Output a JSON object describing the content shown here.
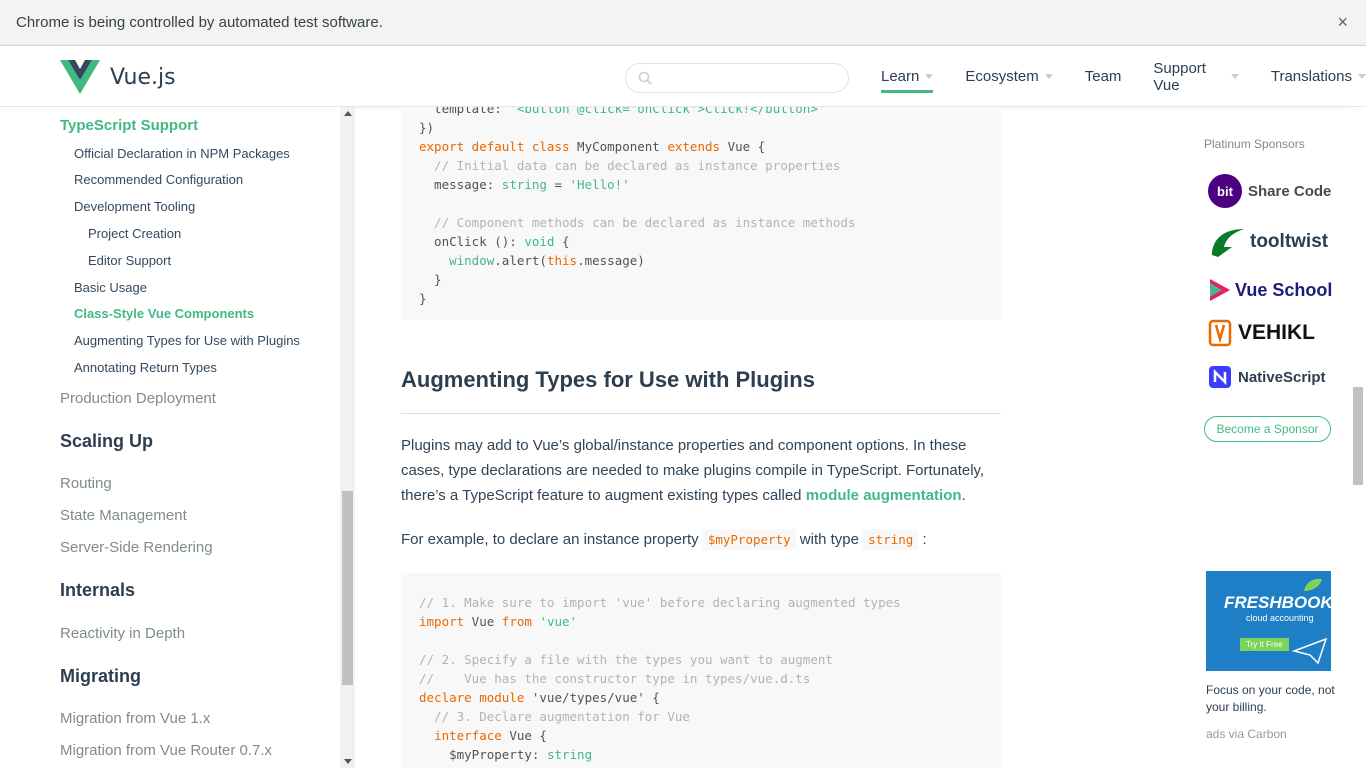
{
  "infobar": {
    "message": "Chrome is being controlled by automated test software.",
    "close": "×"
  },
  "header": {
    "logo_text": "Vue.js",
    "search_placeholder": "",
    "nav": [
      {
        "label": "Learn",
        "active": true,
        "dropdown": true
      },
      {
        "label": "Ecosystem",
        "dropdown": true
      },
      {
        "label": "Team",
        "dropdown": false
      },
      {
        "label": "Support Vue",
        "dropdown": true
      },
      {
        "label": "Translations",
        "dropdown": true
      }
    ]
  },
  "sidebar": {
    "items": [
      {
        "label": "TypeScript Support"
      },
      {
        "label": "Official Declaration in NPM Packages"
      },
      {
        "label": "Recommended Configuration"
      },
      {
        "label": "Development Tooling"
      },
      {
        "label": "Project Creation"
      },
      {
        "label": "Editor Support"
      },
      {
        "label": "Basic Usage"
      },
      {
        "label": "Class-Style Vue Components"
      },
      {
        "label": "Augmenting Types for Use with Plugins"
      },
      {
        "label": "Annotating Return Types"
      },
      {
        "label": "Production Deployment"
      },
      {
        "label": "Scaling Up"
      },
      {
        "label": "Routing"
      },
      {
        "label": "State Management"
      },
      {
        "label": "Server-Side Rendering"
      },
      {
        "label": "Internals"
      },
      {
        "label": "Reactivity in Depth"
      },
      {
        "label": "Migrating"
      },
      {
        "label": "Migration from Vue 1.x"
      },
      {
        "label": "Migration from Vue Router 0.7.x"
      }
    ]
  },
  "content": {
    "code1": [
      {
        "parts": [
          {
            "t": "  template: ",
            "c": ""
          },
          {
            "t": "'<button @click=\"onClick\">Click!</button>'",
            "c": "str"
          }
        ]
      },
      {
        "parts": [
          {
            "t": "})",
            "c": ""
          }
        ]
      },
      {
        "parts": [
          {
            "t": "export default class",
            "c": "kw"
          },
          {
            "t": " MyComponent ",
            "c": ""
          },
          {
            "t": "extends",
            "c": "kw"
          },
          {
            "t": " Vue {",
            "c": ""
          }
        ]
      },
      {
        "parts": [
          {
            "t": "  // Initial data can be declared as instance properties",
            "c": "cm"
          }
        ]
      },
      {
        "parts": [
          {
            "t": "  message: ",
            "c": ""
          },
          {
            "t": "string",
            "c": "str"
          },
          {
            "t": " = ",
            "c": ""
          },
          {
            "t": "'Hello!'",
            "c": "str"
          }
        ]
      },
      {
        "parts": [
          {
            "t": "",
            "c": ""
          }
        ]
      },
      {
        "parts": [
          {
            "t": "  // Component methods can be declared as instance methods",
            "c": "cm"
          }
        ]
      },
      {
        "parts": [
          {
            "t": "  onClick (): ",
            "c": ""
          },
          {
            "t": "void",
            "c": "str"
          },
          {
            "t": " {",
            "c": ""
          }
        ]
      },
      {
        "parts": [
          {
            "t": "    ",
            "c": ""
          },
          {
            "t": "window",
            "c": "str"
          },
          {
            "t": ".alert(",
            "c": ""
          },
          {
            "t": "this",
            "c": "kw"
          },
          {
            "t": ".message)",
            "c": ""
          }
        ]
      },
      {
        "parts": [
          {
            "t": "  }",
            "c": ""
          }
        ]
      },
      {
        "parts": [
          {
            "t": "}",
            "c": ""
          }
        ]
      }
    ],
    "heading": "Augmenting Types for Use with Plugins",
    "para1_a": "Plugins may add to Vue’s global/instance properties and component options. In these cases, type declarations are needed to make plugins compile in TypeScript. Fortunately, there’s a TypeScript feature to augment existing types called ",
    "para1_link": "module augmentation",
    "para1_b": ".",
    "para2_a": "For example, to declare an instance property ",
    "para2_code1": "$myProperty",
    "para2_b": " with type ",
    "para2_code2": "string",
    "para2_c": " :",
    "code2": [
      {
        "parts": [
          {
            "t": "// 1. Make sure to import 'vue' before declaring augmented types",
            "c": "cm"
          }
        ]
      },
      {
        "parts": [
          {
            "t": "import",
            "c": "kw"
          },
          {
            "t": " Vue ",
            "c": ""
          },
          {
            "t": "from",
            "c": "kw"
          },
          {
            "t": " ",
            "c": ""
          },
          {
            "t": "'vue'",
            "c": "str"
          }
        ]
      },
      {
        "parts": [
          {
            "t": "",
            "c": ""
          }
        ]
      },
      {
        "parts": [
          {
            "t": "// 2. Specify a file with the types you want to augment",
            "c": "cm"
          }
        ]
      },
      {
        "parts": [
          {
            "t": "//    Vue has the constructor type in types/vue.d.ts",
            "c": "cm"
          }
        ]
      },
      {
        "parts": [
          {
            "t": "declare module",
            "c": "kw"
          },
          {
            "t": " 'vue/types/vue' {",
            "c": ""
          }
        ]
      },
      {
        "parts": [
          {
            "t": "  // 3. Declare augmentation for Vue",
            "c": "cm"
          }
        ]
      },
      {
        "parts": [
          {
            "t": "  ",
            "c": ""
          },
          {
            "t": "interface",
            "c": "kw"
          },
          {
            "t": " Vue {",
            "c": ""
          }
        ]
      },
      {
        "parts": [
          {
            "t": "    $myProperty: ",
            "c": ""
          },
          {
            "t": "string",
            "c": "str"
          }
        ]
      }
    ]
  },
  "sponsors": {
    "title": "Platinum Sponsors",
    "items": [
      {
        "name": "Share Code",
        "icon_text": "bit",
        "color": "#4b0082"
      },
      {
        "name": "tooltwist",
        "color": "#0a7a2d"
      },
      {
        "name": "Vue School",
        "color": "#1c1c7c"
      },
      {
        "name": "VEHIKL",
        "color": "#e96900"
      },
      {
        "name": "NativeScript",
        "color": "#3c3cff"
      }
    ],
    "become": "Become a Sponsor",
    "ad": {
      "brand": "FRESHBOOKS",
      "sub": "cloud accounting",
      "button": "Try It Free",
      "text": "Focus on your code, not your billing.",
      "carbon": "ads via Carbon"
    }
  }
}
